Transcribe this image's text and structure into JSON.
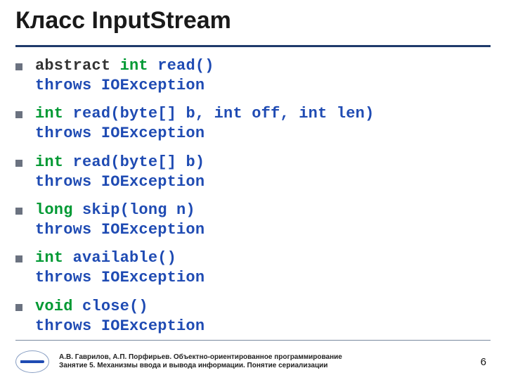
{
  "title": "Класс InputStream",
  "items": [
    {
      "abstract": "abstract ",
      "ret": "int",
      "sig": " read()",
      "throws": "throws IOException"
    },
    {
      "abstract": "",
      "ret": "int",
      "sig": " read(byte[] b, int off, int len)",
      "throws": "throws IOException"
    },
    {
      "abstract": "",
      "ret": "int",
      "sig": " read(byte[] b)",
      "throws": "throws IOException"
    },
    {
      "abstract": "",
      "ret": "long",
      "sig": " skip(long n)",
      "throws": "throws IOException"
    },
    {
      "abstract": "",
      "ret": "int",
      "sig": " available()",
      "throws": "throws IOException"
    },
    {
      "abstract": "",
      "ret": "void",
      "sig": " close()",
      "throws": "throws IOException"
    }
  ],
  "footer": {
    "line1": "А.В. Гаврилов, А.П. Порфирьев. Объектно-ориентированное программирование",
    "line2": "Занятие 5. Механизмы ввода и вывода информации. Понятие сериализации"
  },
  "page": "6"
}
